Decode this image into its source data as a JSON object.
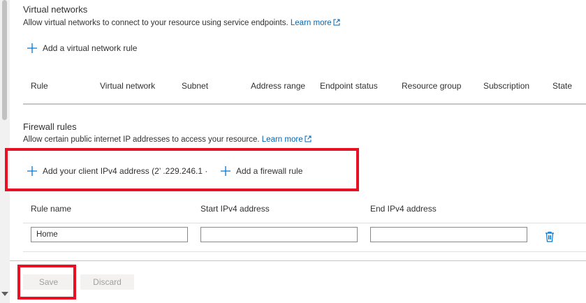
{
  "virtual_networks": {
    "title": "Virtual networks",
    "description": "Allow virtual networks to connect to your resource using service endpoints.",
    "learn_more": "Learn more",
    "add_rule_label": "Add a virtual network rule",
    "columns": [
      "Rule",
      "Virtual network",
      "Subnet",
      "Address range",
      "Endpoint status",
      "Resource group",
      "Subscription",
      "State"
    ]
  },
  "firewall": {
    "title": "Firewall rules",
    "description": "Allow certain public internet IP addresses to access your resource.",
    "learn_more": "Learn more",
    "add_client_label": "Add your client IPv4 address (2’ .229.246.1  ·",
    "add_firewall_label": "Add a firewall rule",
    "columns": [
      "Rule name",
      "Start IPv4 address",
      "End IPv4 address"
    ],
    "rows": [
      {
        "rule_name": "Home",
        "start_ip": "",
        "end_ip": ""
      }
    ]
  },
  "footer": {
    "save_label": "Save",
    "discard_label": "Discard"
  },
  "colors": {
    "link": "#0067b8",
    "highlight": "#e81123",
    "icon_blue": "#0078d4"
  },
  "icons": {
    "add": "plus-icon",
    "external": "external-link-icon",
    "delete": "trash-icon"
  }
}
